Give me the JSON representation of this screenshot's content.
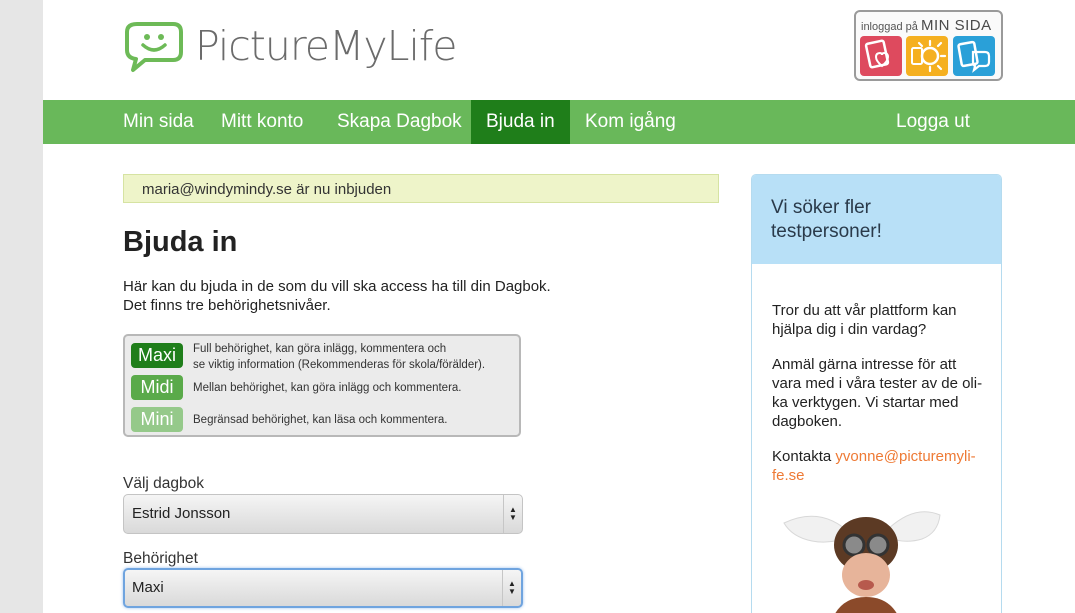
{
  "brand": {
    "name": "PictureMyLife"
  },
  "min_sida": {
    "prefix": "inloggad på",
    "title": "MIN SIDA"
  },
  "nav": {
    "items": [
      {
        "label": "Min sida"
      },
      {
        "label": "Mitt konto"
      },
      {
        "label": "Skapa Dagbok"
      },
      {
        "label": "Bjuda in",
        "active": true
      },
      {
        "label": "Kom igång"
      }
    ],
    "logout": "Logga ut"
  },
  "notice": "maria@windymindy.se är nu inbjuden",
  "main": {
    "title": "Bjuda in",
    "intro_line1": "Här kan du bjuda in de som du vill ska access ha till din Dagbok.",
    "intro_line2": "Det finns tre behörighetsnivåer.",
    "levels": [
      {
        "name": "Maxi",
        "line1": "Full behörighet, kan göra inlägg, kommentera och",
        "line2": "se viktig information (Rekommenderas för skola/förälder)."
      },
      {
        "name": "Midi",
        "line1": "Mellan behörighet, kan göra inlägg och kommentera."
      },
      {
        "name": "Mini",
        "line1": "Begränsad behörighet, kan läsa och kommentera."
      }
    ],
    "diary_label": "Välj dagbok",
    "diary_value": "Estrid Jonsson",
    "permission_label": "Behörighet",
    "permission_value": "Maxi"
  },
  "sidebar": {
    "title": "Vi söker fler testpersoner!",
    "p1": "Tror du att vår plattform kan hjälpa dig i din vardag?",
    "p2": "Anmäl gärna intresse för att vara med i våra tester av de oli-ka verktygen. Vi startar med dagboken.",
    "contact_prefix": "Kontakta",
    "contact_email": "yvonne@picturemyli-fe.se"
  },
  "colors": {
    "nav_green": "#69b85a",
    "nav_active": "#1f7e1a",
    "maxi": "#1f7e1a",
    "midi": "#5aaa4a",
    "mini": "#95c98a",
    "link_orange": "#ee7a35",
    "sidebar_head": "#b8e0f7"
  }
}
